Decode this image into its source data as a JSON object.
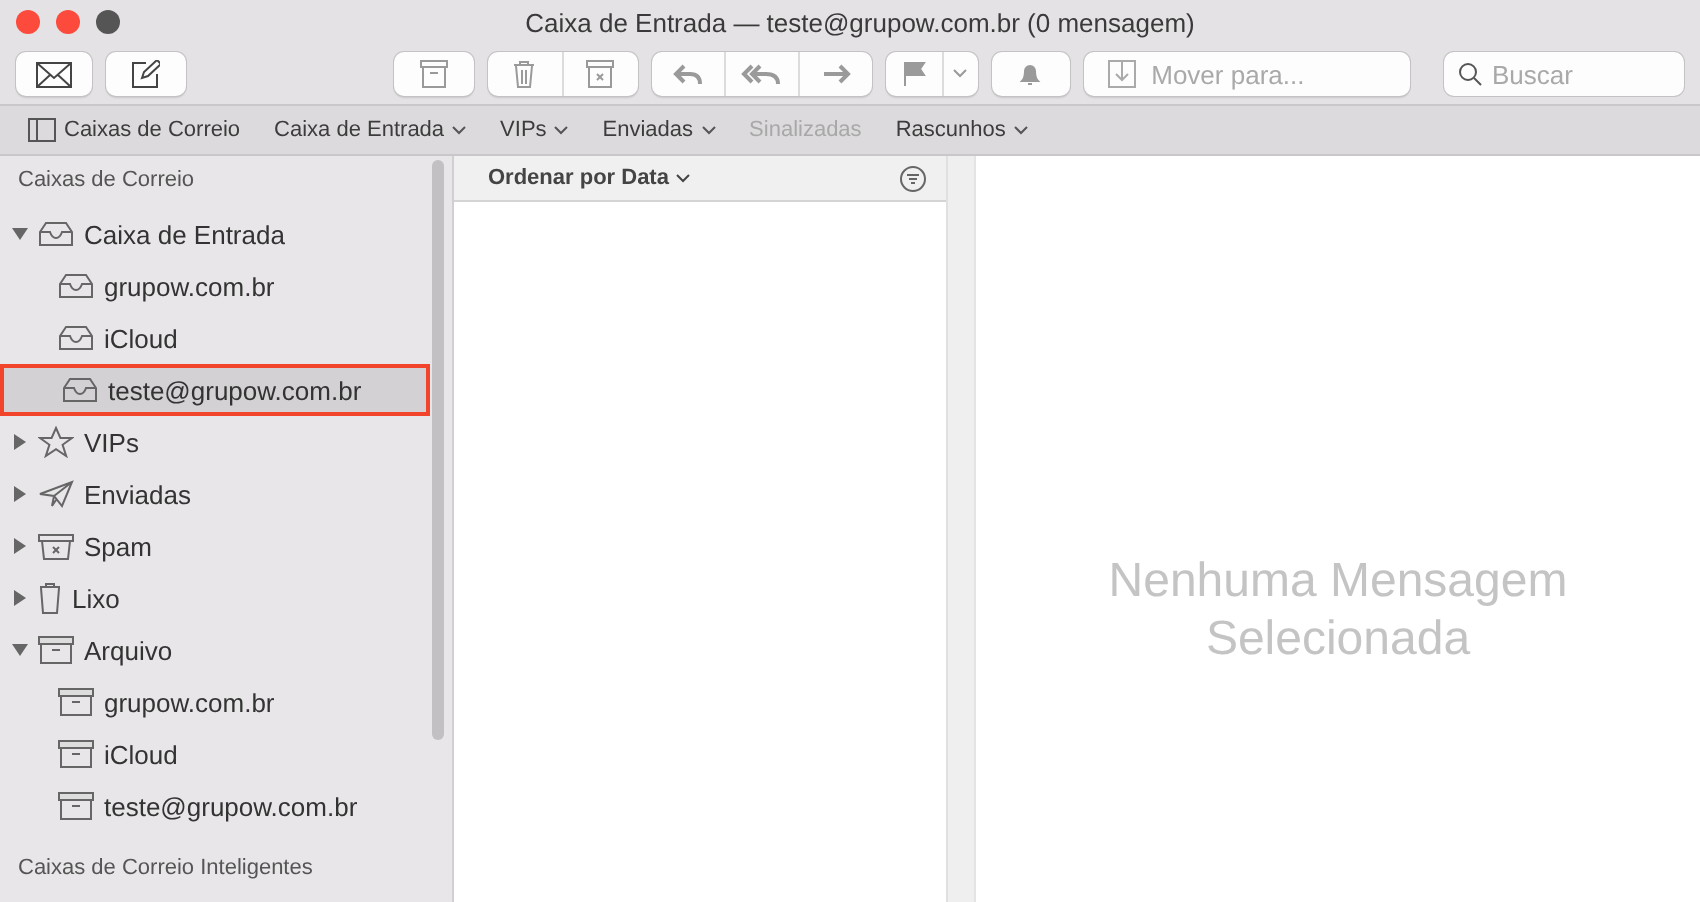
{
  "window": {
    "title": "Caixa de Entrada — teste@grupow.com.br (0 mensagem)"
  },
  "toolbar": {
    "groups": [
      {
        "buttons": [
          {
            "kind": "get-mail"
          }
        ]
      },
      {
        "buttons": [
          {
            "kind": "compose"
          }
        ]
      },
      {
        "buttons": [
          {
            "kind": "archive"
          }
        ]
      },
      {
        "buttons": [
          {
            "kind": "trash"
          },
          {
            "kind": "junk"
          }
        ]
      },
      {
        "buttons": [
          {
            "kind": "reply"
          },
          {
            "kind": "reply-all"
          },
          {
            "kind": "forward"
          }
        ]
      },
      {
        "buttons": [
          {
            "kind": "flag"
          },
          {
            "kind": "caret"
          }
        ]
      },
      {
        "buttons": [
          {
            "kind": "bell"
          }
        ]
      }
    ],
    "move_to": {
      "placeholder": "Mover para..."
    },
    "search": {
      "placeholder": "Buscar"
    }
  },
  "favorites_bar": [
    {
      "kind": "sidebar-toggle",
      "label": "Caixas de Correio",
      "menu": false,
      "disabled": false
    },
    {
      "kind": "mailbox",
      "label": "Caixa de Entrada",
      "menu": true,
      "disabled": false
    },
    {
      "kind": "mailbox",
      "label": "VIPs",
      "menu": true,
      "disabled": false
    },
    {
      "kind": "mailbox",
      "label": "Enviadas",
      "menu": true,
      "disabled": false
    },
    {
      "kind": "mailbox",
      "label": "Sinalizadas",
      "menu": false,
      "disabled": true
    },
    {
      "kind": "mailbox",
      "label": "Rascunhos",
      "menu": true,
      "disabled": false
    }
  ],
  "sidebar": {
    "sections": [
      {
        "title": "Caixas de Correio",
        "items": [
          {
            "kind": "inbox",
            "label": "Caixa de Entrada",
            "expanded": true,
            "selected": false,
            "children": [
              {
                "kind": "inbox",
                "label": "grupow.com.br",
                "selected": false
              },
              {
                "kind": "inbox",
                "label": "iCloud",
                "selected": false
              },
              {
                "kind": "inbox",
                "label": "teste@grupow.com.br",
                "selected": true
              }
            ]
          },
          {
            "kind": "star",
            "label": "VIPs",
            "expanded": false,
            "selected": false
          },
          {
            "kind": "sent",
            "label": "Enviadas",
            "expanded": false,
            "selected": false
          },
          {
            "kind": "junk",
            "label": "Spam",
            "expanded": false,
            "selected": false
          },
          {
            "kind": "trash",
            "label": "Lixo",
            "expanded": false,
            "selected": false
          },
          {
            "kind": "archive",
            "label": "Arquivo",
            "expanded": true,
            "selected": false,
            "children": [
              {
                "kind": "archive",
                "label": "grupow.com.br",
                "selected": false
              },
              {
                "kind": "archive",
                "label": "iCloud",
                "selected": false
              },
              {
                "kind": "archive",
                "label": "teste@grupow.com.br",
                "selected": false
              }
            ]
          }
        ]
      },
      {
        "title": "Caixas de Correio Inteligentes"
      }
    ]
  },
  "message_list": {
    "sort_label": "Ordenar por Data"
  },
  "viewer": {
    "empty_message": "Nenhuma Mensagem Selecionada"
  }
}
